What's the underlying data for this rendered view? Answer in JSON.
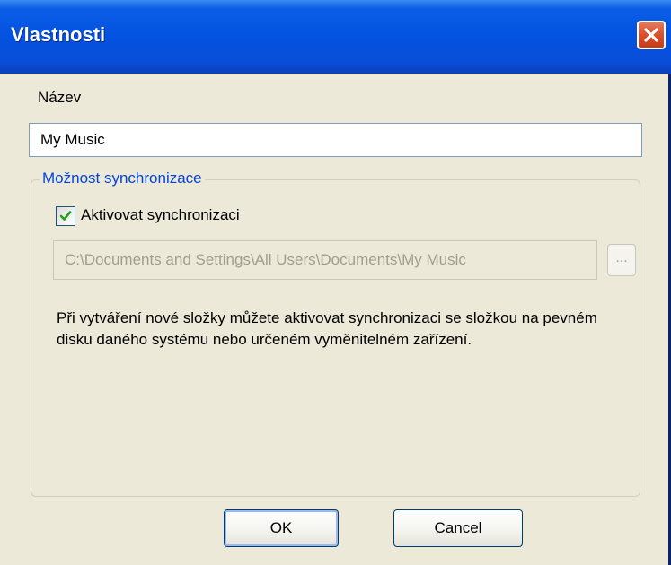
{
  "window": {
    "title": "Vlastnosti"
  },
  "name_field": {
    "label": "Název",
    "value": "My Music"
  },
  "sync_group": {
    "legend": "Možnost synchronizace",
    "enable_label": "Aktivovat synchronizaci",
    "enabled": true,
    "path_value": "C:\\Documents and Settings\\All Users\\Documents\\My Music",
    "browse_label": "...",
    "description": "Při vytváření nové složky můžete aktivovat synchronizaci se složkou na pevném disku daného systému nebo určeném vyměnitelném zařízení."
  },
  "buttons": {
    "ok": "OK",
    "cancel": "Cancel"
  },
  "icons": {
    "close": "close-icon",
    "check": "check-icon"
  },
  "colors": {
    "titlebar": "#0352e0",
    "close": "#d9512c",
    "legend": "#0046d5",
    "check": "#21a121"
  }
}
